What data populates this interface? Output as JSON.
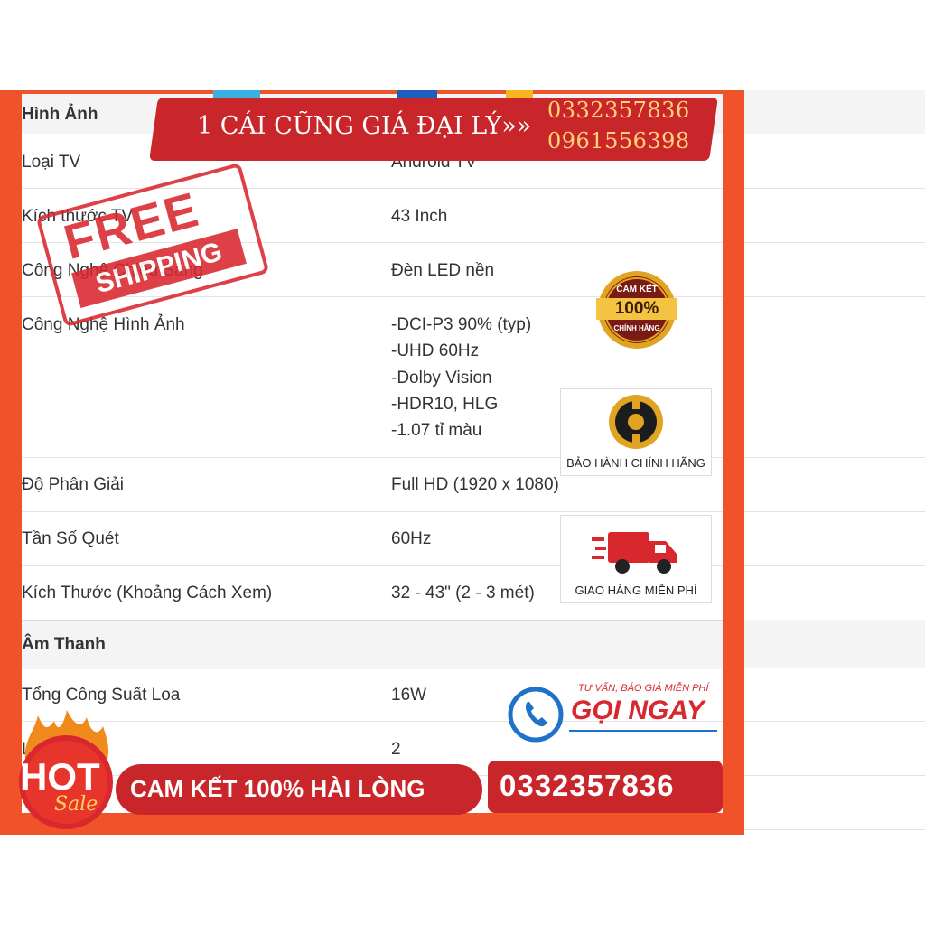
{
  "spec_table": {
    "sections": [
      {
        "title": "Hình Ảnh",
        "rows": [
          {
            "label": "Loại TV",
            "value": "Android TV"
          },
          {
            "label": "Kích thước TV",
            "value": "43 Inch"
          },
          {
            "label": "Công Nghệ Chiếu Sáng",
            "value": "Đèn LED nền"
          },
          {
            "label": "Công Nghệ Hình Ảnh",
            "values": [
              "-DCI-P3 90% (typ)",
              "-UHD 60Hz",
              "-Dolby Vision",
              "-HDR10, HLG",
              "-1.07 tỉ màu"
            ]
          },
          {
            "label": "Độ Phân Giải",
            "value": "Full HD (1920 x 1080)"
          },
          {
            "label": "Tần Số Quét",
            "value": "60Hz"
          },
          {
            "label": "Kích Thước (Khoảng Cách Xem)",
            "value": "32 - 43\" (2 - 3 mét)"
          }
        ]
      },
      {
        "title": "Âm Thanh",
        "rows": [
          {
            "label": "Tổng Công Suất Loa",
            "value": "16W"
          },
          {
            "label": "Loa",
            "value": "2"
          }
        ]
      }
    ]
  },
  "promo": {
    "top_banner": "1 CÁI CŨNG GIÁ ĐẠI LÝ»»",
    "phones": [
      "0332357836",
      "0961556398"
    ],
    "stamp": {
      "line1": "FREE",
      "line2": "SHIPPING"
    },
    "badge_100": {
      "top": "CAM KẾT",
      "middle": "100%",
      "bottom": "CHÍNH HÃNG"
    },
    "warranty_caption": "BẢO HÀNH CHÍNH HÃNG",
    "delivery_caption": "GIAO HÀNG MIỄN PHÍ",
    "call": {
      "tagline": "TƯ VẤN, BÁO GIÁ MIỄN PHÍ",
      "action": "GỌI NGAY"
    },
    "hot": {
      "line1": "HOT",
      "line2": "Sale"
    },
    "bottom_banner": "CAM KẾT 100% HÀI LÒNG",
    "bottom_phone": "0332357836"
  },
  "colors": {
    "frame": "#f0522a",
    "banner_red": "#c8262b",
    "stamp_red": "#d9272e",
    "gold": "#e0a422"
  }
}
